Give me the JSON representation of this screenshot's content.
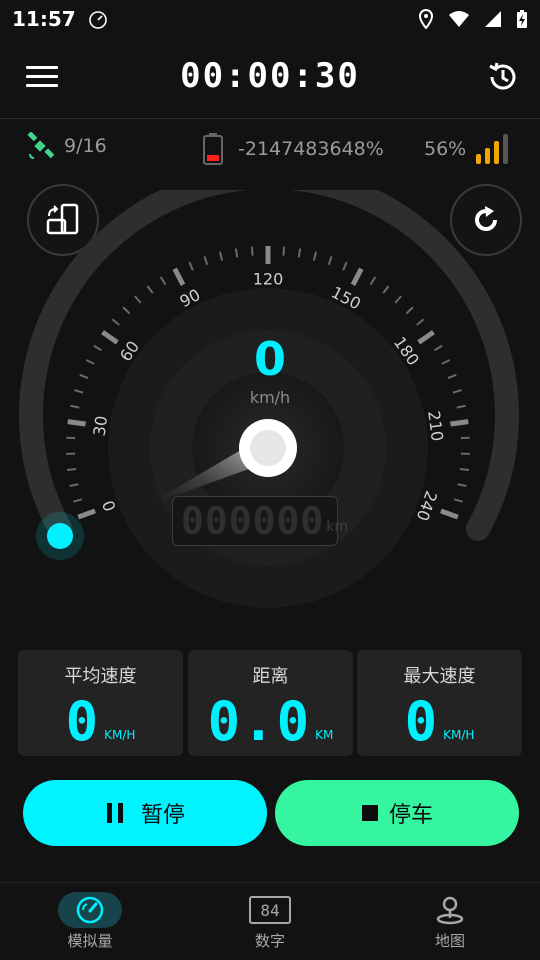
{
  "status_bar": {
    "time": "11:57"
  },
  "header": {
    "timer": "00:00:30"
  },
  "info": {
    "satellites": "9/16",
    "battery": "-2147483648%",
    "signal": "56%"
  },
  "gauge": {
    "speed": "0",
    "unit": "km/h",
    "ticks": [
      "0",
      "30",
      "60",
      "90",
      "120",
      "150",
      "180",
      "210",
      "240"
    ],
    "odometer": "000000",
    "odometer_unit": "km",
    "speed_fraction": 0
  },
  "stats": {
    "avg": {
      "title": "平均速度",
      "value": "0",
      "unit": "KM/H"
    },
    "distance": {
      "title": "距离",
      "value": "0.0",
      "unit": "KM"
    },
    "max": {
      "title": "最大速度",
      "value": "0",
      "unit": "KM/H"
    }
  },
  "actions": {
    "pause": "暂停",
    "stop": "停车"
  },
  "nav": {
    "tabs": [
      {
        "label": "模拟量"
      },
      {
        "label": "数字",
        "icon_text": "84"
      },
      {
        "label": "地图"
      }
    ]
  },
  "colors": {
    "accent": "#00f0ff",
    "green": "#36f5a0",
    "signal": "#f0a500",
    "sat": "#3fd68a",
    "battery": "#ff2020"
  }
}
